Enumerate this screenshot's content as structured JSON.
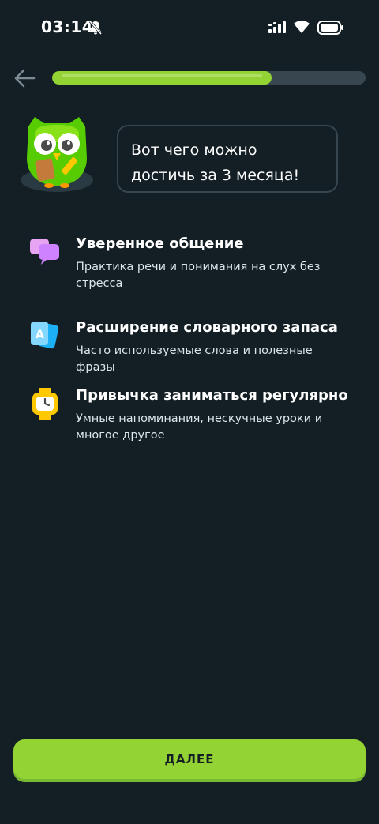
{
  "status_bar": {
    "time": "03:14",
    "icons": [
      "bell-off-icon",
      "signal-icon",
      "wifi-icon",
      "battery-icon"
    ]
  },
  "progress": {
    "fraction": 0.7,
    "color": "#93d333",
    "track_color": "#37464f"
  },
  "mascot": {
    "icon": "owl-mascot-icon",
    "speech": "Вот чего можно достичь за 3 месяца!"
  },
  "features": [
    {
      "icon": "chat-bubbles-icon",
      "title": "Уверенное общение",
      "description": "Практика речи и понимания на слух без стресса"
    },
    {
      "icon": "flashcards-icon",
      "title": "Расширение словарного запаса",
      "description": "Часто используемые слова и полезные фразы"
    },
    {
      "icon": "watch-icon",
      "title": "Привычка заниматься регулярно",
      "description": "Умные напоминания, нескучные уроки и многое другое"
    }
  ],
  "continue_button": {
    "label": "ДАЛЕЕ",
    "color": "#93d333"
  },
  "colors": {
    "background": "#131f24",
    "accent": "#93d333"
  }
}
